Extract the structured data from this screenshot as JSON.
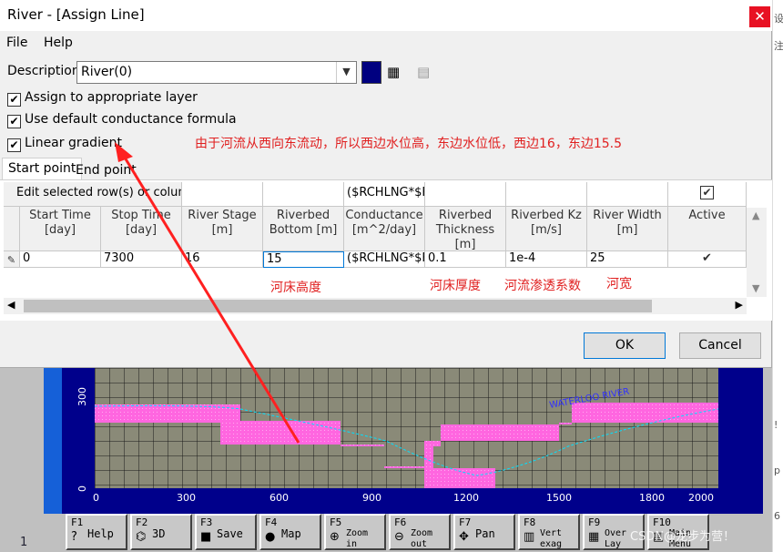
{
  "window": {
    "title": "River - [Assign Line]",
    "close_glyph": "✕"
  },
  "menu": [
    "File",
    "Help"
  ],
  "description": {
    "label": "Description:",
    "value": "River(0)",
    "color": "#000080"
  },
  "checkboxes": [
    {
      "label": "Assign to appropriate layer",
      "checked": true
    },
    {
      "label": "Use default conductance formula",
      "checked": true
    },
    {
      "label": "Linear gradient",
      "checked": true
    }
  ],
  "note": "由于河流从西向东流动，所以西边水位高，东边水位低，西边16，东边15.5",
  "tabs": [
    {
      "label": "Start point",
      "active": true
    },
    {
      "label": "End point",
      "active": false
    }
  ],
  "grid": {
    "edit_label": "Edit selected row(s) or column:",
    "edit_formula": "($RCHLNG*$F",
    "headers": [
      "Start Time [day]",
      "Stop Time [day]",
      "River Stage [m]",
      "Riverbed Bottom [m]",
      "Conductance [m^2/day]",
      "Riverbed Thickness [m]",
      "Riverbed Kz [m/s]",
      "River Width [m]",
      "Active"
    ],
    "row": [
      "0",
      "7300",
      "16",
      "15",
      "($RCHLNG*$F",
      "0.1",
      "1e-4",
      "25",
      "✔"
    ]
  },
  "annotations": {
    "bottom": "河床高度",
    "thickness": "河床厚度",
    "kz": "河流渗透系数",
    "width": "河宽"
  },
  "buttons": {
    "ok": "OK",
    "cancel": "Cancel"
  },
  "background": {
    "y_ticks": [
      "300",
      "0"
    ],
    "x_ticks": [
      "0",
      "300",
      "600",
      "900",
      "1200",
      "1500",
      "1800",
      "2000"
    ],
    "map_label": "WATERLOO   RIVER",
    "fkeys": [
      {
        "key": "F1",
        "label": "Help",
        "icon": "?"
      },
      {
        "key": "F2",
        "label": "3D",
        "icon": "⌬"
      },
      {
        "key": "F3",
        "label": "Save",
        "icon": "■"
      },
      {
        "key": "F4",
        "label": "Map",
        "icon": "●"
      },
      {
        "key": "F5",
        "label": "Zoom in",
        "icon": "⊕"
      },
      {
        "key": "F6",
        "label": "Zoom out",
        "icon": "⊖"
      },
      {
        "key": "F7",
        "label": "Pan",
        "icon": "✥"
      },
      {
        "key": "F8",
        "label": "Vert exag",
        "icon": "▥"
      },
      {
        "key": "F9",
        "label": "Over Lay",
        "icon": "▦"
      },
      {
        "key": "F10",
        "label": "Main Menu",
        "icon": "▤"
      }
    ],
    "left_number": "1",
    "watermark": "CSDN@龙步为营！",
    "right_fragments": [
      "设",
      "注",
      "!",
      "p",
      "6"
    ]
  }
}
